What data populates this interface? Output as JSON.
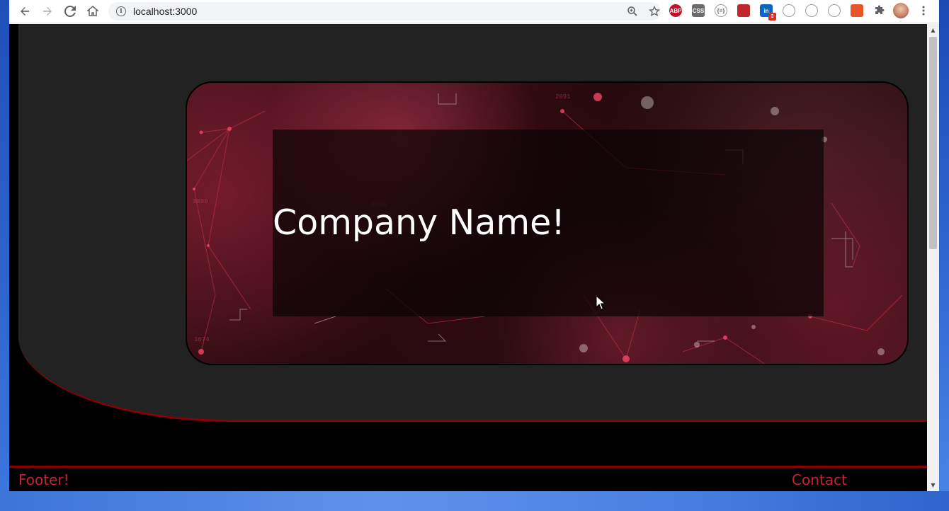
{
  "browser": {
    "url": "localhost:3000"
  },
  "extensions": [
    {
      "name": "adblock-plus-icon",
      "label": "ABP",
      "color": "#c70d2c"
    },
    {
      "name": "css-viewer-icon",
      "label": "CSS",
      "color": "#6b6b6b"
    },
    {
      "name": "json-viewer-icon",
      "label": "{=}",
      "color": "#ffffff"
    },
    {
      "name": "red-extension-icon",
      "label": "",
      "color": "#c0262c"
    },
    {
      "name": "linkedin-icon",
      "label": "in",
      "color": "#0a66c2",
      "badge": "3"
    },
    {
      "name": "dark-mode-icon",
      "label": "",
      "color": "#ffffff"
    },
    {
      "name": "colorful-extension-icon",
      "label": "",
      "color": "#ffffff"
    },
    {
      "name": "circle-extension-icon",
      "label": "",
      "color": "#ffffff"
    },
    {
      "name": "orange-extension-icon",
      "label": "",
      "color": "#e8542a"
    }
  ],
  "page": {
    "hero_title": "Company Name!",
    "footer_left": "Footer!",
    "footer_right": "Contact"
  },
  "colors": {
    "accent": "#8b0000",
    "footer_text": "#c0262c",
    "page_bg": "#222222"
  }
}
